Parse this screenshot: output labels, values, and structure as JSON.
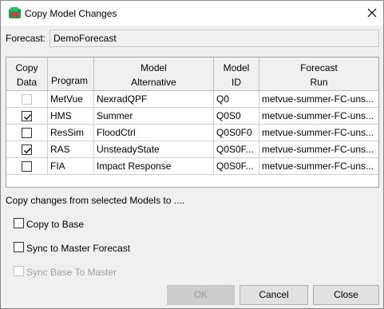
{
  "window": {
    "title": "Copy Model Changes"
  },
  "forecast": {
    "label": "Forecast:",
    "value": "DemoForecast"
  },
  "table": {
    "headers": {
      "copy_line1": "Copy",
      "copy_line2": "Data",
      "program": "Program",
      "alt_line1": "Model",
      "alt_line2": "Alternative",
      "id_line1": "Model",
      "id_line2": "ID",
      "run_line1": "Forecast",
      "run_line2": "Run"
    },
    "rows": [
      {
        "checked": false,
        "enabled": false,
        "program": "MetVue",
        "alternative": "NexradQPF",
        "model_id": "Q0",
        "run": "metvue-summer-FC-uns..."
      },
      {
        "checked": true,
        "enabled": true,
        "program": "HMS",
        "alternative": "Summer",
        "model_id": "Q0S0",
        "run": "metvue-summer-FC-uns..."
      },
      {
        "checked": false,
        "enabled": true,
        "program": "ResSim",
        "alternative": "FloodCtrl",
        "model_id": "Q0S0F0",
        "run": "metvue-summer-FC-uns..."
      },
      {
        "checked": true,
        "enabled": true,
        "program": "RAS",
        "alternative": "UnsteadyState",
        "model_id": "Q0S0F...",
        "run": "metvue-summer-FC-uns..."
      },
      {
        "checked": false,
        "enabled": true,
        "program": "FIA",
        "alternative": "Impact Response",
        "model_id": "Q0S0F...",
        "run": "metvue-summer-FC-uns..."
      }
    ]
  },
  "copy_section": {
    "label": "Copy changes from selected Models to ...."
  },
  "options": {
    "copy_to_base": {
      "label": "Copy to Base",
      "checked": false,
      "enabled": true
    },
    "sync_to_master": {
      "label": "Sync to Master Forecast",
      "checked": false,
      "enabled": true
    },
    "sync_base_to_master": {
      "label": "Sync Base To Master",
      "checked": false,
      "enabled": false
    }
  },
  "buttons": {
    "ok": "OK",
    "cancel": "Cancel",
    "close": "Close"
  }
}
